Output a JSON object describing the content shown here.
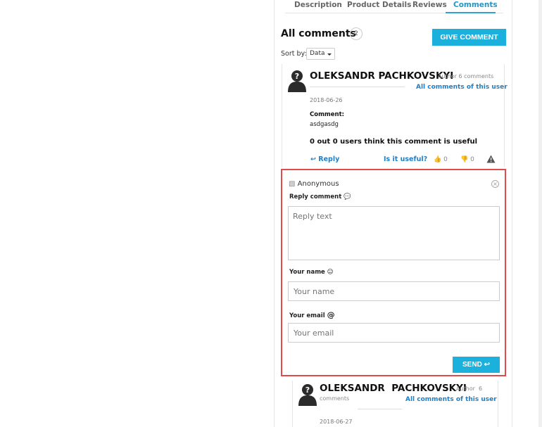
{
  "tabs": [
    {
      "label": "Description"
    },
    {
      "label": "Product Details"
    },
    {
      "label": "Reviews"
    },
    {
      "label": "Comments",
      "active": true
    }
  ],
  "comments_section": {
    "title": "All comments",
    "count": "2",
    "give_comment_label": "GIVE COMMENT",
    "sort_label": "Sort by:",
    "sort_value": "Data"
  },
  "comments": [
    {
      "author": "OLEKSANDR PACHKOVSKYI",
      "author_meta": "Author 6 comments",
      "all_comments_link": "All comments of this user",
      "date": "2018-06-26",
      "comment_label": "Comment:",
      "comment_text": "asdgasdg",
      "useful_summary": "0 out 0 users think this comment is useful",
      "reply_label": "Reply",
      "is_useful_label": "Is it useful?",
      "likes": "0",
      "dislikes": "0"
    },
    {
      "author": "OLEKSANDR  PACHKOVSKYI",
      "author_meta_1": "Author  6",
      "author_meta_2": "comments",
      "all_comments_link": "All comments of this user",
      "date": "2018-06-27"
    }
  ],
  "reply_form": {
    "user": "Anonymous",
    "reply_comment_label": "Reply comment",
    "reply_placeholder": "Reply text",
    "name_label": "Your name",
    "name_placeholder": "Your name",
    "email_label": "Your email",
    "email_symbol": "@",
    "email_placeholder": "Your email",
    "send_label": "SEND"
  },
  "colors": {
    "accent": "#1cb0dc",
    "link": "#1f7fc7",
    "form_border": "#e14b4b"
  }
}
